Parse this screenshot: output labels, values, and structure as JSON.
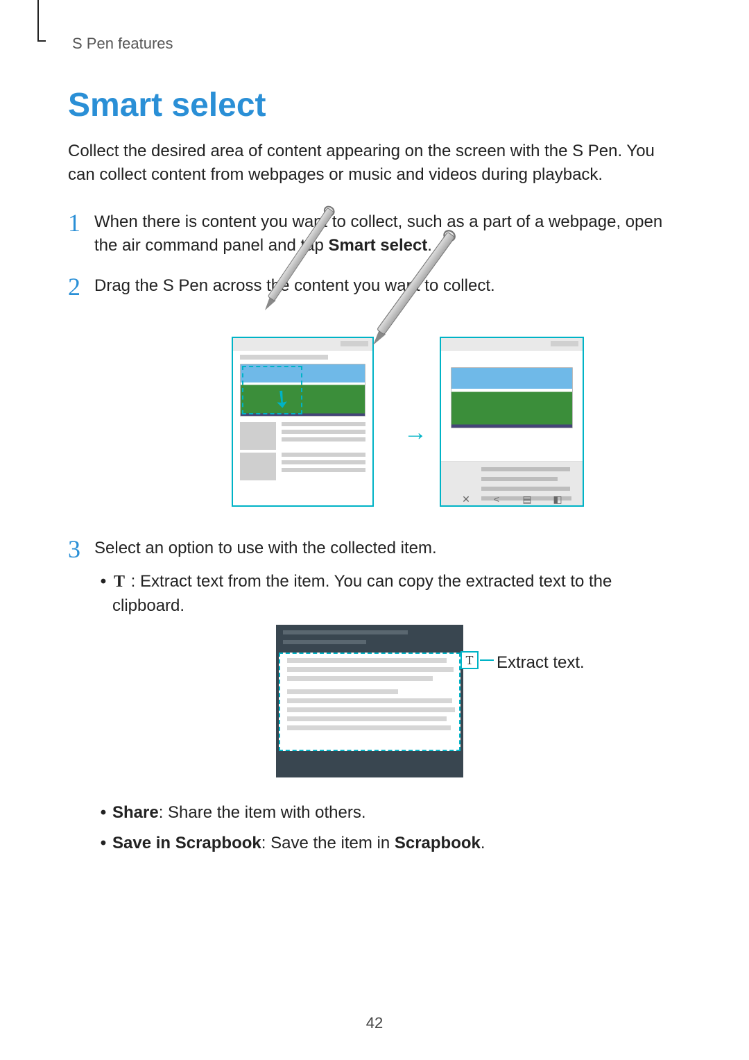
{
  "breadcrumb": "S Pen features",
  "title": "Smart select",
  "intro": "Collect the desired area of content appearing on the screen with the S Pen. You can collect content from webpages or music and videos during playback.",
  "steps": {
    "s1": {
      "num": "1",
      "text_a": "When there is content you want to collect, such as a part of a webpage, open the air command panel and tap ",
      "bold": "Smart select",
      "text_b": "."
    },
    "s2": {
      "num": "2",
      "text": "Drag the S Pen across the content you want to collect."
    },
    "s3": {
      "num": "3",
      "text": "Select an option to use with the collected item.",
      "b1": {
        "icon": "T",
        "text": " : Extract text from the item. You can copy the extracted text to the clipboard."
      },
      "b2": {
        "bold": "Share",
        "text": ": Share the item with others."
      },
      "b3": {
        "bold": "Save in Scrapbook",
        "text_a": ": Save the item in ",
        "bold2": "Scrapbook",
        "text_b": "."
      }
    }
  },
  "fig2_caption": "Extract text.",
  "fig2_icon": "T",
  "page_number": "42"
}
